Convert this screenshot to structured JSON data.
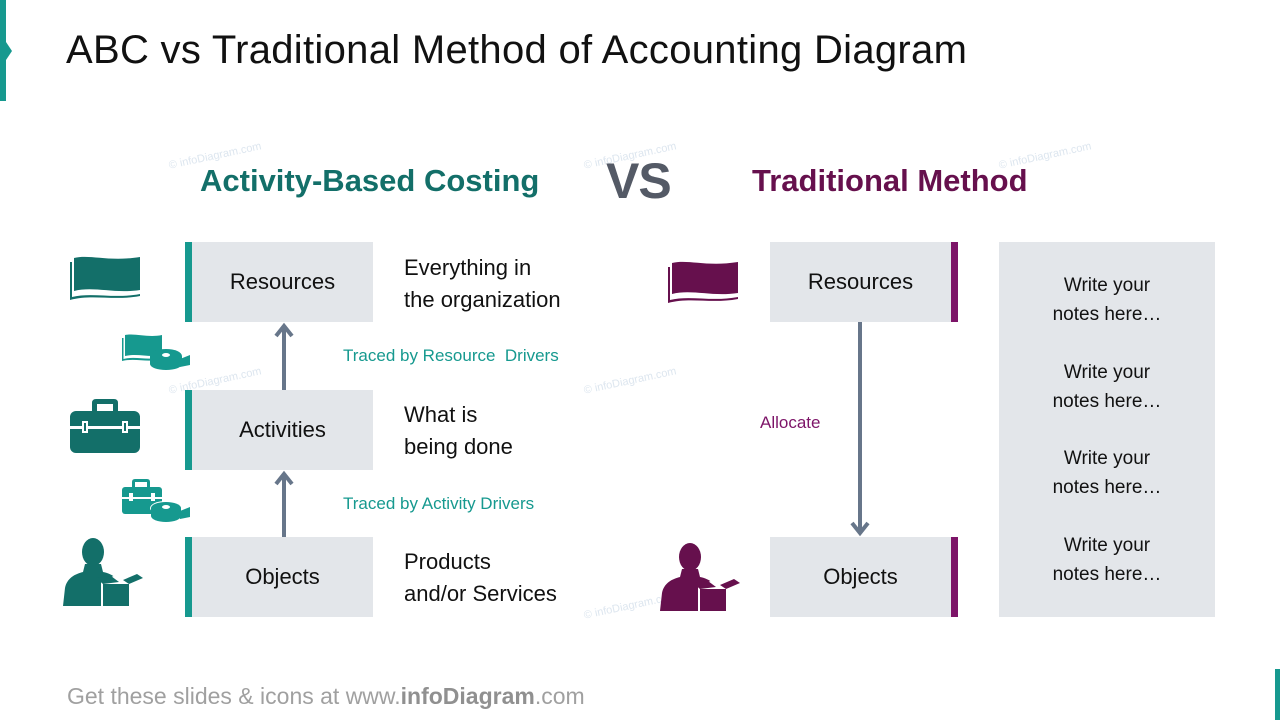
{
  "slide": {
    "title": "ABC vs Traditional Method of Accounting Diagram"
  },
  "colors": {
    "teal": "#16998f",
    "dark_teal": "#136f69",
    "purple": "#7d1468",
    "dark_purple": "#66104d",
    "slate": "#545a66",
    "arrow": "#67768a",
    "box_fill": "#e3e6ea"
  },
  "headers": {
    "abc": "Activity-Based Costing",
    "vs": "VS",
    "traditional": "Traditional Method"
  },
  "watermark": "© infoDiagram.com",
  "abc": {
    "levels": [
      {
        "label": "Resources",
        "description_line1": "Everything in",
        "description_line2": "the organization",
        "icon": "flag-icon"
      },
      {
        "label": "Activities",
        "description_line1": "What is",
        "description_line2": "being done",
        "icon": "toolbox-icon"
      },
      {
        "label": "Objects",
        "description_line1": "Products",
        "description_line2": "and/or Services",
        "icon": "person-with-box-icon"
      }
    ],
    "drivers": [
      {
        "label": "Traced by Resource  Drivers",
        "icon": "flag-measuring-tape-icon"
      },
      {
        "label": "Traced by Activity Drivers",
        "icon": "toolbox-measuring-tape-icon"
      }
    ]
  },
  "traditional": {
    "levels": [
      {
        "label": "Resources",
        "icon": "flag-icon"
      },
      {
        "label": "Objects",
        "icon": "person-with-box-icon"
      }
    ],
    "connector_label": "Allocate"
  },
  "notes": [
    {
      "line1": "Write your",
      "line2": "notes here…"
    },
    {
      "line1": "Write your",
      "line2": "notes here…"
    },
    {
      "line1": "Write your",
      "line2": "notes here…"
    },
    {
      "line1": "Write your",
      "line2": "notes here…"
    }
  ],
  "footer": {
    "prefix": "Get these slides & icons at www.",
    "brand": "infoDiagram",
    "suffix": ".com"
  }
}
